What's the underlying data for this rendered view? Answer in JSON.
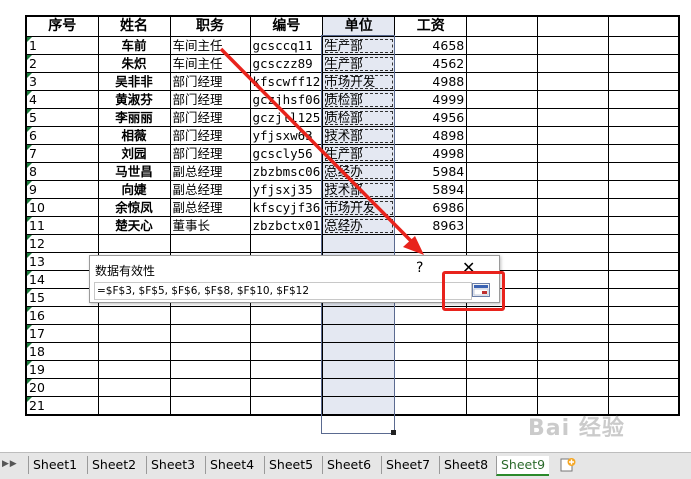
{
  "table": {
    "headers": [
      "序号",
      "姓名",
      "职务",
      "编号",
      "单位",
      "工资"
    ],
    "rows": [
      [
        "1",
        "车前",
        "车间主任",
        "gcsccq11",
        "生产部",
        "4658"
      ],
      [
        "2",
        "朱炽",
        "车间主任",
        "gcsczz89",
        "生产部",
        "4562"
      ],
      [
        "3",
        "吴非非",
        "部门经理",
        "kfscwff12",
        "市场开发",
        "4988"
      ],
      [
        "4",
        "黄淑芬",
        "部门经理",
        "gczjhsf06",
        "质检部",
        "4999"
      ],
      [
        "5",
        "李丽丽",
        "部门经理",
        "gczjll125",
        "质检部",
        "4956"
      ],
      [
        "6",
        "相薇",
        "部门经理",
        "yfjsxw63",
        "技术部",
        "4898"
      ],
      [
        "7",
        "刘园",
        "部门经理",
        "gcscly56",
        "生产部",
        "4998"
      ],
      [
        "8",
        "马世昌",
        "副总经理",
        "zbzbmsc06",
        "总经办",
        "5984"
      ],
      [
        "9",
        "向婕",
        "副总经理",
        "yfjsxj35",
        "技术部",
        "5894"
      ],
      [
        "10",
        "余惊凤",
        "副总经理",
        "kfscyjf36",
        "市场开发",
        "6986"
      ],
      [
        "11",
        "楚天心",
        "董事长",
        "zbzbctx01",
        "总经办",
        "8963"
      ],
      [
        "12",
        "",
        "",
        "",
        "",
        ""
      ],
      [
        "13",
        "",
        "",
        "",
        "",
        ""
      ],
      [
        "14",
        "",
        "",
        "",
        "",
        ""
      ],
      [
        "15",
        "",
        "",
        "",
        "",
        ""
      ],
      [
        "16",
        "",
        "",
        "",
        "",
        ""
      ],
      [
        "17",
        "",
        "",
        "",
        "",
        ""
      ],
      [
        "18",
        "",
        "",
        "",
        "",
        ""
      ],
      [
        "19",
        "",
        "",
        "",
        "",
        ""
      ],
      [
        "20",
        "",
        "",
        "",
        "",
        ""
      ],
      [
        "21",
        "",
        "",
        "",
        "",
        ""
      ]
    ]
  },
  "dialog": {
    "title": "数据有效性",
    "help": "?",
    "close": "✕",
    "formula": "=$F$3, $F$5, $F$6, $F$8, $F$10, $F$12"
  },
  "tabs": {
    "nav": "▶ ▶",
    "sheets": [
      "Sheet1",
      "Sheet2",
      "Sheet3",
      "Sheet4",
      "Sheet5",
      "Sheet6",
      "Sheet7",
      "Sheet8",
      "Sheet9"
    ],
    "active": "Sheet9"
  },
  "watermark": "Bai 经验",
  "colors": {
    "highlight": "#e8231c",
    "arrow": "#e8231c",
    "selection": "#e4e8f2"
  },
  "icons": {
    "collapse": "range-collapse-icon",
    "add": "add-sheet-icon"
  }
}
